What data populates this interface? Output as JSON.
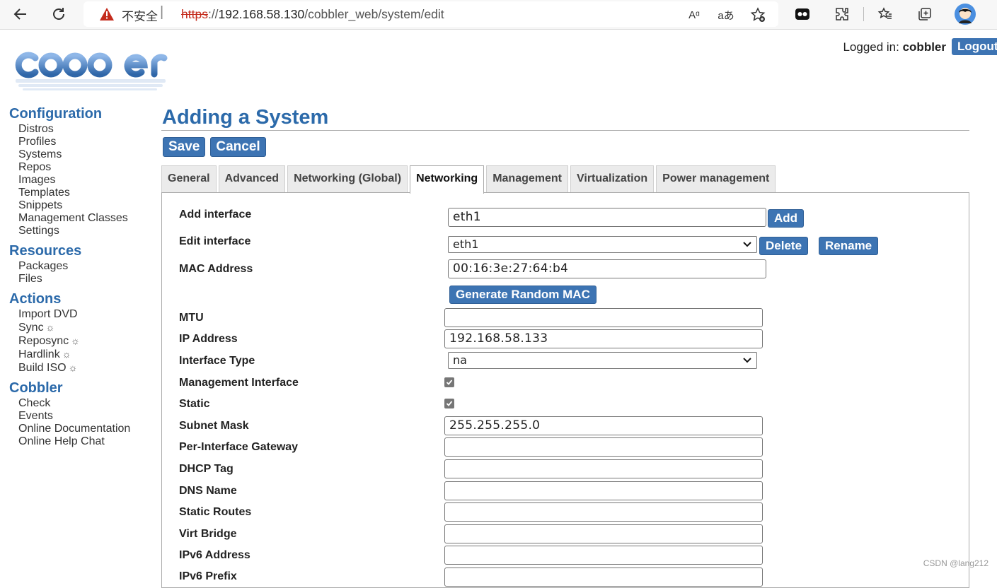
{
  "browser": {
    "insecure_label": "不安全",
    "separator": "|",
    "url_scheme": "https",
    "url_sep": "://",
    "url_host": "192.168.58.130",
    "url_path": "/cobbler_web/system/edit",
    "read_aloud_label": "Aᵅ",
    "translate_label": "aあ"
  },
  "header": {
    "logo_text": "cobbler",
    "logged_in_label": "Logged in:",
    "user": "cobbler",
    "logout_label": "Logout"
  },
  "sidebar": {
    "sections": [
      {
        "title": "Configuration",
        "items": [
          "Distros",
          "Profiles",
          "Systems",
          "Repos",
          "Images",
          "Templates",
          "Snippets",
          "Management Classes",
          "Settings"
        ]
      },
      {
        "title": "Resources",
        "items": [
          "Packages",
          "Files"
        ]
      },
      {
        "title": "Actions",
        "items": [
          "Import DVD",
          "Sync",
          "Reposync",
          "Hardlink",
          "Build ISO"
        ]
      },
      {
        "title": "Cobbler",
        "items": [
          "Check",
          "Events",
          "Online Documentation",
          "Online Help Chat"
        ]
      }
    ],
    "sun_glyph": "☼"
  },
  "main": {
    "title": "Adding a System",
    "save_label": "Save",
    "cancel_label": "Cancel",
    "tabs": [
      "General",
      "Advanced",
      "Networking (Global)",
      "Networking",
      "Management",
      "Virtualization",
      "Power management"
    ],
    "active_tab": "Networking"
  },
  "form": {
    "add_interface": {
      "label": "Add interface",
      "value": "eth1",
      "button": "Add"
    },
    "edit_interface": {
      "label": "Edit interface",
      "value": "eth1",
      "delete": "Delete",
      "rename": "Rename"
    },
    "mac": {
      "label": "MAC Address",
      "value": "00:16:3e:27:64:b4",
      "generate": "Generate Random MAC"
    },
    "mtu": {
      "label": "MTU",
      "value": ""
    },
    "ip": {
      "label": "IP Address",
      "value": "192.168.58.133"
    },
    "interface_type": {
      "label": "Interface Type",
      "value": "na"
    },
    "management_interface": {
      "label": "Management Interface",
      "checked": true
    },
    "static": {
      "label": "Static",
      "checked": true
    },
    "subnet_mask": {
      "label": "Subnet Mask",
      "value": "255.255.255.0"
    },
    "gateway": {
      "label": "Per-Interface Gateway",
      "value": ""
    },
    "dhcp_tag": {
      "label": "DHCP Tag",
      "value": ""
    },
    "dns_name": {
      "label": "DNS Name",
      "value": ""
    },
    "static_routes": {
      "label": "Static Routes",
      "value": ""
    },
    "virt_bridge": {
      "label": "Virt Bridge",
      "value": ""
    },
    "ipv6": {
      "label": "IPv6 Address",
      "value": ""
    },
    "ipv6_prefix": {
      "label": "IPv6 Prefix",
      "value": ""
    }
  },
  "watermark": "CSDN @lang212",
  "colors": {
    "accent": "#3d74b3",
    "heading": "#2c6aaa"
  }
}
